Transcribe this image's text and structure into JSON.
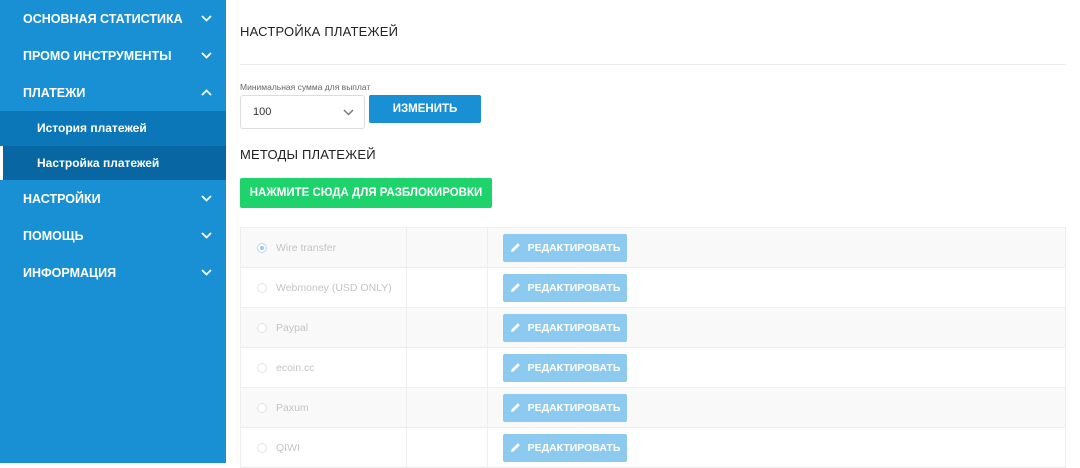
{
  "sidebar": {
    "items": [
      {
        "label": "ОСНОВНАЯ СТАТИСТИКА",
        "icon": "chevron-down-icon"
      },
      {
        "label": "ПРОМО ИНСТРУМЕНТЫ",
        "icon": "chevron-down-icon"
      },
      {
        "label": "ПЛАТЕЖИ",
        "icon": "chevron-up-icon"
      },
      {
        "label": "НАСТРОЙКИ",
        "icon": "chevron-down-icon"
      },
      {
        "label": "ПОМОЩЬ",
        "icon": "chevron-down-icon"
      },
      {
        "label": "ИНФОРМАЦИЯ",
        "icon": "chevron-down-icon"
      }
    ],
    "subitems": [
      {
        "label": "История платежей"
      },
      {
        "label": "Настройка платежей"
      }
    ]
  },
  "main": {
    "title": "НАСТРОЙКА ПЛАТЕЖЕЙ",
    "min_payout_label": "Минимальная сумма для выплат",
    "min_payout_value": "100",
    "change_button": "ИЗМЕНИТЬ",
    "methods_title": "МЕТОДЫ ПЛАТЕЖЕЙ",
    "unlock_button": "НАЖМИТЕ СЮДА ДЛЯ РАЗБЛОКИРОВКИ",
    "methods": [
      {
        "name": "Wire transfer",
        "edit_label": "РЕДАКТИРОВАТЬ"
      },
      {
        "name": "Webmoney (USD ONLY)",
        "edit_label": "РЕДАКТИРОВАТЬ"
      },
      {
        "name": "Paypal",
        "edit_label": "РЕДАКТИРОВАТЬ"
      },
      {
        "name": "ecoin.cc",
        "edit_label": "РЕДАКТИРОВАТЬ"
      },
      {
        "name": "Paxum",
        "edit_label": "РЕДАКТИРОВАТЬ"
      },
      {
        "name": "QIWI",
        "edit_label": "РЕДАКТИРОВАТЬ"
      }
    ]
  },
  "colors": {
    "sidebar_bg": "#1a90d4",
    "sidebar_sub_bg": "#0b76b8",
    "primary_button": "#1a90d4",
    "unlock_button": "#1ed26c",
    "edit_button": "#8ccaf0"
  }
}
